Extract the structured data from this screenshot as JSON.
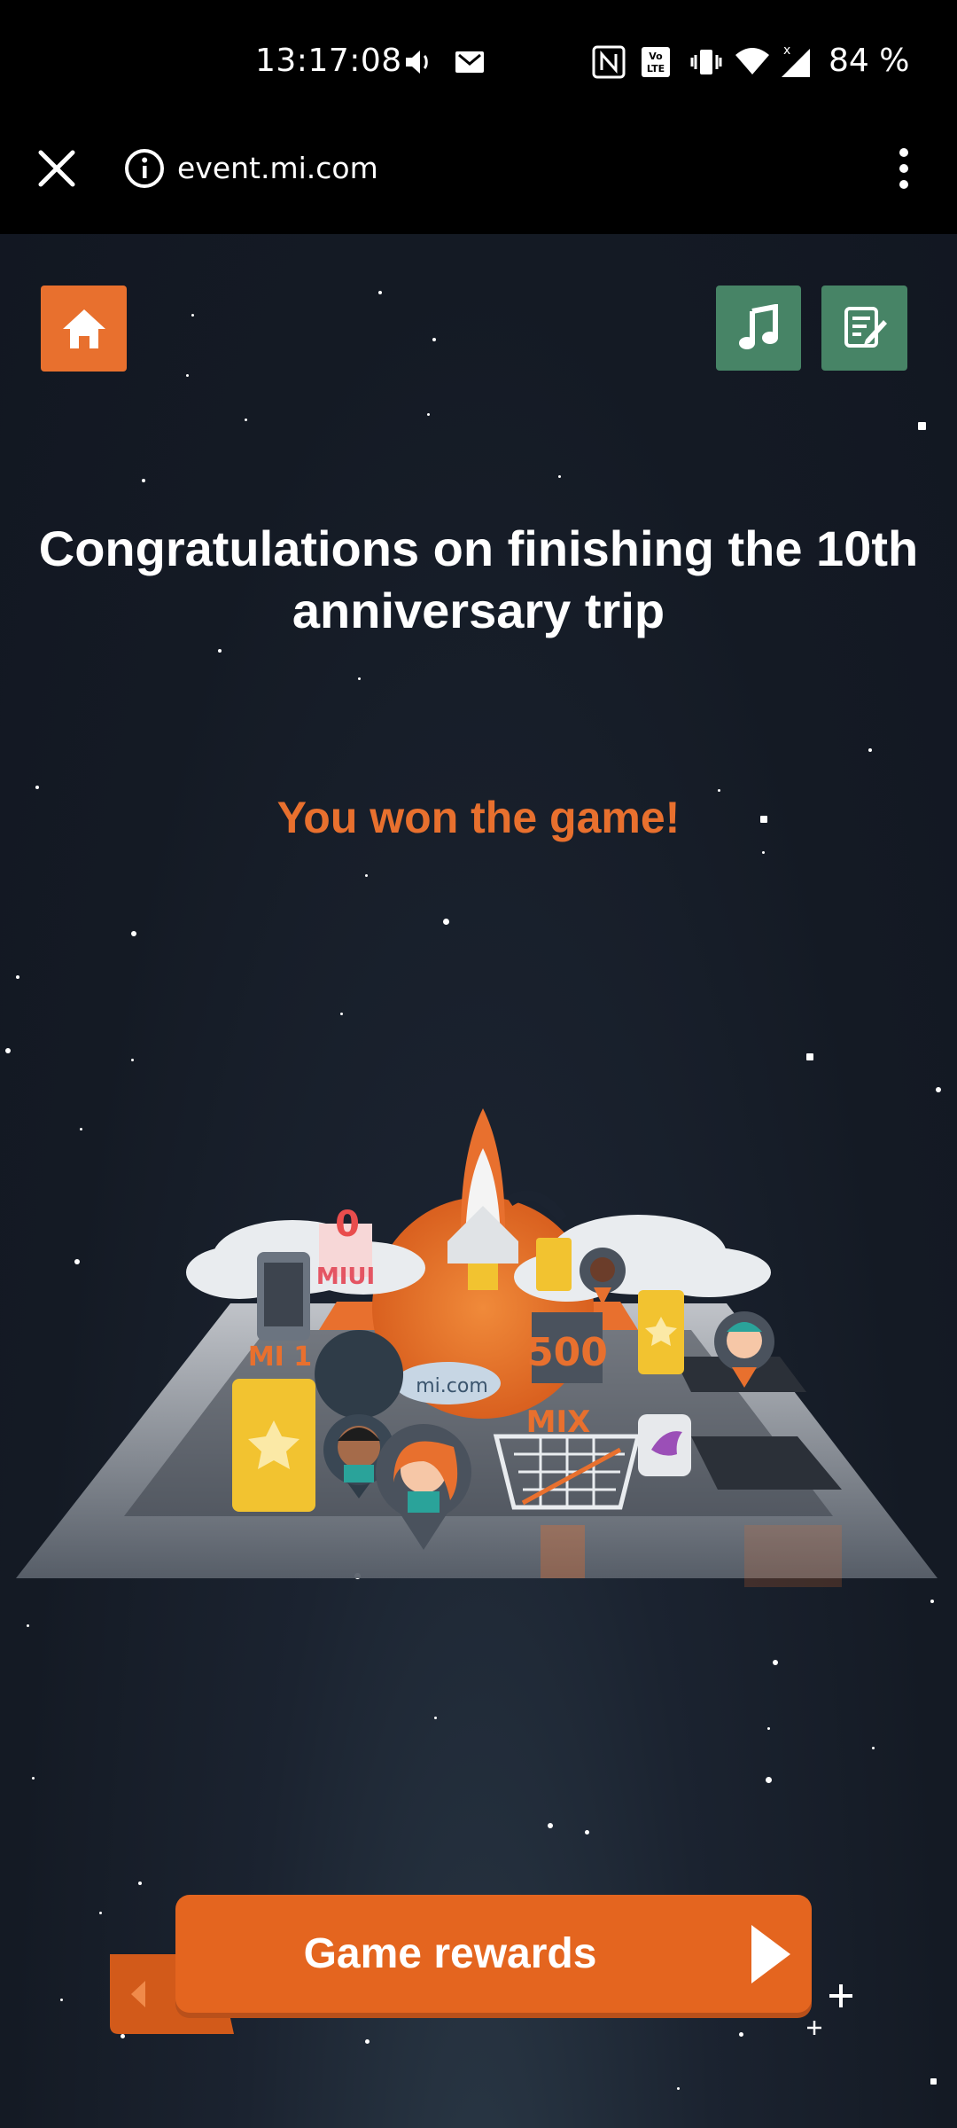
{
  "status_bar": {
    "time": "13:17:08",
    "battery": "84 %",
    "icons": [
      "volume-icon",
      "gmail-icon",
      "nfc-icon",
      "volte-icon",
      "vibrate-icon",
      "wifi-icon",
      "signal-icon"
    ]
  },
  "browser": {
    "url": "event.mi.com",
    "icons": [
      "close-icon",
      "info-icon",
      "more-vert-icon"
    ]
  },
  "game": {
    "title": "Congratulations on finishing the 10th anniversary trip",
    "subtitle": "You won the game!",
    "top_buttons": [
      "home-icon",
      "music-icon",
      "notes-icon"
    ],
    "board_labels": {
      "miui": "MIUI",
      "mi1": "MI 1",
      "micom": "mi.com",
      "count": "500",
      "mix": "MIX",
      "ten": "0"
    },
    "rewards_button": "Game rewards"
  },
  "colors": {
    "accent_orange": "#e8702e",
    "green_button": "#478466",
    "background": "#141a24"
  }
}
